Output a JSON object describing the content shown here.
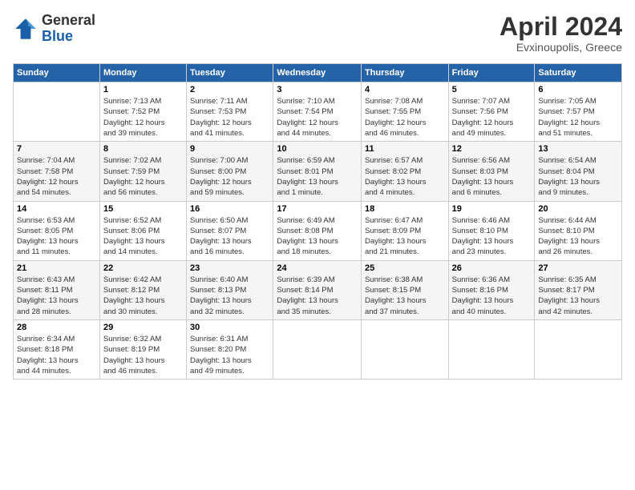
{
  "header": {
    "logo_general": "General",
    "logo_blue": "Blue",
    "month_title": "April 2024",
    "location": "Evxinoupolis, Greece"
  },
  "columns": [
    "Sunday",
    "Monday",
    "Tuesday",
    "Wednesday",
    "Thursday",
    "Friday",
    "Saturday"
  ],
  "weeks": [
    [
      {
        "day": "",
        "info": ""
      },
      {
        "day": "1",
        "info": "Sunrise: 7:13 AM\nSunset: 7:52 PM\nDaylight: 12 hours\nand 39 minutes."
      },
      {
        "day": "2",
        "info": "Sunrise: 7:11 AM\nSunset: 7:53 PM\nDaylight: 12 hours\nand 41 minutes."
      },
      {
        "day": "3",
        "info": "Sunrise: 7:10 AM\nSunset: 7:54 PM\nDaylight: 12 hours\nand 44 minutes."
      },
      {
        "day": "4",
        "info": "Sunrise: 7:08 AM\nSunset: 7:55 PM\nDaylight: 12 hours\nand 46 minutes."
      },
      {
        "day": "5",
        "info": "Sunrise: 7:07 AM\nSunset: 7:56 PM\nDaylight: 12 hours\nand 49 minutes."
      },
      {
        "day": "6",
        "info": "Sunrise: 7:05 AM\nSunset: 7:57 PM\nDaylight: 12 hours\nand 51 minutes."
      }
    ],
    [
      {
        "day": "7",
        "info": "Sunrise: 7:04 AM\nSunset: 7:58 PM\nDaylight: 12 hours\nand 54 minutes."
      },
      {
        "day": "8",
        "info": "Sunrise: 7:02 AM\nSunset: 7:59 PM\nDaylight: 12 hours\nand 56 minutes."
      },
      {
        "day": "9",
        "info": "Sunrise: 7:00 AM\nSunset: 8:00 PM\nDaylight: 12 hours\nand 59 minutes."
      },
      {
        "day": "10",
        "info": "Sunrise: 6:59 AM\nSunset: 8:01 PM\nDaylight: 13 hours\nand 1 minute."
      },
      {
        "day": "11",
        "info": "Sunrise: 6:57 AM\nSunset: 8:02 PM\nDaylight: 13 hours\nand 4 minutes."
      },
      {
        "day": "12",
        "info": "Sunrise: 6:56 AM\nSunset: 8:03 PM\nDaylight: 13 hours\nand 6 minutes."
      },
      {
        "day": "13",
        "info": "Sunrise: 6:54 AM\nSunset: 8:04 PM\nDaylight: 13 hours\nand 9 minutes."
      }
    ],
    [
      {
        "day": "14",
        "info": "Sunrise: 6:53 AM\nSunset: 8:05 PM\nDaylight: 13 hours\nand 11 minutes."
      },
      {
        "day": "15",
        "info": "Sunrise: 6:52 AM\nSunset: 8:06 PM\nDaylight: 13 hours\nand 14 minutes."
      },
      {
        "day": "16",
        "info": "Sunrise: 6:50 AM\nSunset: 8:07 PM\nDaylight: 13 hours\nand 16 minutes."
      },
      {
        "day": "17",
        "info": "Sunrise: 6:49 AM\nSunset: 8:08 PM\nDaylight: 13 hours\nand 18 minutes."
      },
      {
        "day": "18",
        "info": "Sunrise: 6:47 AM\nSunset: 8:09 PM\nDaylight: 13 hours\nand 21 minutes."
      },
      {
        "day": "19",
        "info": "Sunrise: 6:46 AM\nSunset: 8:10 PM\nDaylight: 13 hours\nand 23 minutes."
      },
      {
        "day": "20",
        "info": "Sunrise: 6:44 AM\nSunset: 8:10 PM\nDaylight: 13 hours\nand 26 minutes."
      }
    ],
    [
      {
        "day": "21",
        "info": "Sunrise: 6:43 AM\nSunset: 8:11 PM\nDaylight: 13 hours\nand 28 minutes."
      },
      {
        "day": "22",
        "info": "Sunrise: 6:42 AM\nSunset: 8:12 PM\nDaylight: 13 hours\nand 30 minutes."
      },
      {
        "day": "23",
        "info": "Sunrise: 6:40 AM\nSunset: 8:13 PM\nDaylight: 13 hours\nand 32 minutes."
      },
      {
        "day": "24",
        "info": "Sunrise: 6:39 AM\nSunset: 8:14 PM\nDaylight: 13 hours\nand 35 minutes."
      },
      {
        "day": "25",
        "info": "Sunrise: 6:38 AM\nSunset: 8:15 PM\nDaylight: 13 hours\nand 37 minutes."
      },
      {
        "day": "26",
        "info": "Sunrise: 6:36 AM\nSunset: 8:16 PM\nDaylight: 13 hours\nand 40 minutes."
      },
      {
        "day": "27",
        "info": "Sunrise: 6:35 AM\nSunset: 8:17 PM\nDaylight: 13 hours\nand 42 minutes."
      }
    ],
    [
      {
        "day": "28",
        "info": "Sunrise: 6:34 AM\nSunset: 8:18 PM\nDaylight: 13 hours\nand 44 minutes."
      },
      {
        "day": "29",
        "info": "Sunrise: 6:32 AM\nSunset: 8:19 PM\nDaylight: 13 hours\nand 46 minutes."
      },
      {
        "day": "30",
        "info": "Sunrise: 6:31 AM\nSunset: 8:20 PM\nDaylight: 13 hours\nand 49 minutes."
      },
      {
        "day": "",
        "info": ""
      },
      {
        "day": "",
        "info": ""
      },
      {
        "day": "",
        "info": ""
      },
      {
        "day": "",
        "info": ""
      }
    ]
  ]
}
